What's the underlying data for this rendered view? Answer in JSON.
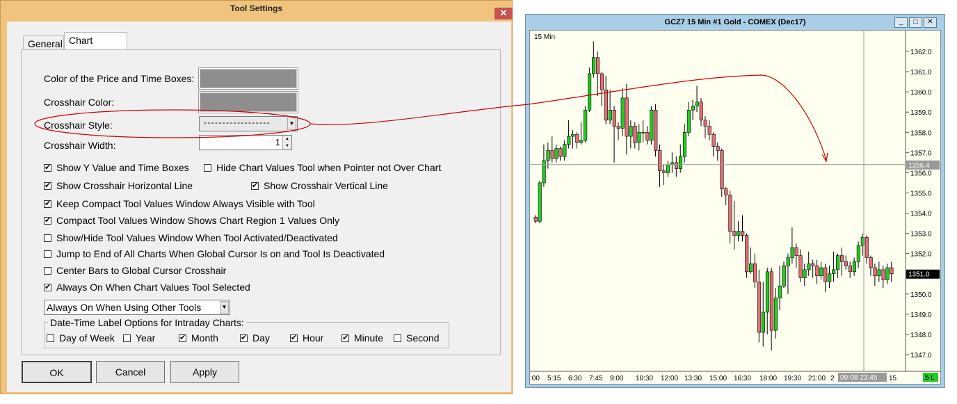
{
  "dialog": {
    "title": "Tool Settings",
    "close_glyph": "✕",
    "tabs": [
      {
        "label": "General"
      },
      {
        "label": "Chart Values"
      }
    ],
    "fields": {
      "price_time_boxes_color_label": "Color of the Price and Time Boxes:",
      "crosshair_color_label": "Crosshair Color:",
      "crosshair_style_label": "Crosshair Style:",
      "crosshair_style_value": "- - - - - - - - - - - - - - - - - -",
      "crosshair_width_label": "Crosshair Width:",
      "crosshair_width_value": "1",
      "swatch_color": "#8e8e8e"
    },
    "checkboxes": [
      {
        "label": "Show Y Value and Time Boxes",
        "checked": true
      },
      {
        "label": "Hide Chart Values Tool when Pointer not Over Chart",
        "checked": false
      },
      {
        "label": "Show Crosshair Horizontal Line",
        "checked": true
      },
      {
        "label": "Show Crosshair Vertical Line",
        "checked": true
      },
      {
        "label": "Keep Compact Tool Values Window Always Visible with Tool",
        "checked": true
      },
      {
        "label": "Compact Tool Values Window Shows Chart Region 1 Values Only",
        "checked": true
      },
      {
        "label": "Show/Hide Tool Values Window When Tool Activated/Deactivated",
        "checked": false
      },
      {
        "label": "Jump to End of All Charts When Global Cursor Is on and Tool Is Deactivated",
        "checked": false
      },
      {
        "label": "Center Bars to Global Cursor Crosshair",
        "checked": false
      },
      {
        "label": "Always On When Chart Values Tool Selected",
        "checked": true
      }
    ],
    "mode_select_value": "Always On When Using Other Tools",
    "date_time_group": {
      "title": "Date-Time Label Options for Intraday Charts:",
      "options": [
        {
          "label": "Day of Week",
          "checked": false
        },
        {
          "label": "Year",
          "checked": false
        },
        {
          "label": "Month",
          "checked": true
        },
        {
          "label": "Day",
          "checked": true
        },
        {
          "label": "Hour",
          "checked": true
        },
        {
          "label": "Minute",
          "checked": true
        },
        {
          "label": "Second",
          "checked": false
        }
      ]
    },
    "buttons": {
      "ok": "OK",
      "cancel": "Cancel",
      "apply": "Apply"
    }
  },
  "chart_window": {
    "title": "GCZ7  15 Min  #1  Gold - COMEX (Dec17)",
    "buttons": [
      "_",
      "□",
      "✕"
    ],
    "period_label": "15 Min",
    "crosshair_price": "1356.4",
    "last_price": "1351.0",
    "crosshair_time": "09-08  23:45",
    "status_badge": "5 L",
    "colors": {
      "up": "#22cc22",
      "down": "#e07070",
      "background": "#fffff0",
      "annotation": "#d00000"
    }
  },
  "chart_data": {
    "type": "candlestick",
    "x_tick_labels": [
      ":00",
      "5:15",
      "6:30",
      "7:45",
      "9:00",
      "10:30",
      "12:00",
      "13:30",
      "15:00",
      "16:30",
      "18:00",
      "19:30",
      "21:00",
      "2",
      "15"
    ],
    "y_tick_labels": [
      "1362.0",
      "1361.0",
      "1360.0",
      "1359.0",
      "1358.0",
      "1357.0",
      "1356.0",
      "1355.0",
      "1354.0",
      "1353.0",
      "1352.0",
      "1351.0",
      "1350.0",
      "1349.0",
      "1348.0",
      "1347.0"
    ],
    "ylim": [
      1346.5,
      1363.0
    ],
    "crosshair": {
      "price": 1356.4,
      "time": "09-08 23:45"
    },
    "candles": [
      [
        1353.8,
        1353.6,
        1353.9,
        1353.5
      ],
      [
        1353.6,
        1355.5,
        1355.6,
        1353.5
      ],
      [
        1355.5,
        1356.6,
        1357.4,
        1355.3
      ],
      [
        1356.6,
        1357.1,
        1357.5,
        1356.2
      ],
      [
        1357.1,
        1356.7,
        1357.8,
        1356.5
      ],
      [
        1356.7,
        1357.2,
        1357.4,
        1356.5
      ],
      [
        1357.2,
        1356.8,
        1357.3,
        1356.6
      ],
      [
        1356.8,
        1357.4,
        1357.6,
        1356.6
      ],
      [
        1357.4,
        1357.8,
        1358.6,
        1357.2
      ],
      [
        1357.8,
        1357.9,
        1358.1,
        1357.2
      ],
      [
        1357.9,
        1357.5,
        1358.0,
        1357.2
      ],
      [
        1357.5,
        1357.6,
        1358.5,
        1357.4
      ],
      [
        1357.6,
        1359.1,
        1359.3,
        1357.5
      ],
      [
        1359.1,
        1360.9,
        1361.2,
        1359.0
      ],
      [
        1360.9,
        1361.7,
        1362.5,
        1360.7
      ],
      [
        1361.7,
        1360.9,
        1362.0,
        1359.8
      ],
      [
        1360.9,
        1360.1,
        1361.0,
        1359.3
      ],
      [
        1360.1,
        1358.6,
        1360.8,
        1358.4
      ],
      [
        1358.6,
        1359.1,
        1360.1,
        1358.4
      ],
      [
        1359.1,
        1358.3,
        1359.3,
        1356.5
      ],
      [
        1358.3,
        1358.2,
        1358.5,
        1357.6
      ],
      [
        1358.2,
        1359.7,
        1360.2,
        1357.8
      ],
      [
        1359.7,
        1357.8,
        1360.4,
        1356.9
      ],
      [
        1357.8,
        1358.3,
        1358.6,
        1357.2
      ],
      [
        1358.3,
        1357.5,
        1358.5,
        1357.2
      ],
      [
        1357.5,
        1358.0,
        1358.4,
        1357.1
      ],
      [
        1358.0,
        1358.0,
        1358.6,
        1357.5
      ],
      [
        1358.0,
        1357.6,
        1358.3,
        1357.4
      ],
      [
        1357.6,
        1359.1,
        1359.3,
        1357.4
      ],
      [
        1359.1,
        1357.1,
        1359.4,
        1356.8
      ],
      [
        1357.1,
        1356.1,
        1357.4,
        1355.3
      ],
      [
        1356.1,
        1356.0,
        1356.4,
        1355.4
      ],
      [
        1356.0,
        1356.4,
        1356.6,
        1355.8
      ],
      [
        1356.4,
        1356.5,
        1357.0,
        1356.0
      ],
      [
        1356.5,
        1356.2,
        1356.8,
        1355.8
      ],
      [
        1356.2,
        1356.8,
        1357.4,
        1356.0
      ],
      [
        1356.8,
        1358.0,
        1358.4,
        1356.5
      ],
      [
        1358.0,
        1359.1,
        1359.5,
        1357.8
      ],
      [
        1359.1,
        1359.3,
        1359.6,
        1358.6
      ],
      [
        1359.3,
        1359.5,
        1360.3,
        1359.0
      ],
      [
        1359.5,
        1358.6,
        1359.7,
        1358.3
      ],
      [
        1358.6,
        1358.3,
        1358.8,
        1357.7
      ],
      [
        1358.3,
        1357.9,
        1358.6,
        1357.6
      ],
      [
        1357.9,
        1357.3,
        1358.0,
        1356.8
      ],
      [
        1357.3,
        1357.1,
        1357.5,
        1356.6
      ],
      [
        1357.1,
        1355.2,
        1357.2,
        1354.8
      ],
      [
        1355.2,
        1354.9,
        1355.3,
        1354.4
      ],
      [
        1354.9,
        1353.1,
        1355.1,
        1352.5
      ],
      [
        1353.1,
        1352.9,
        1354.6,
        1352.2
      ],
      [
        1352.9,
        1353.1,
        1353.6,
        1352.6
      ],
      [
        1353.1,
        1352.9,
        1353.9,
        1352.6
      ],
      [
        1352.9,
        1351.1,
        1353.0,
        1350.8
      ],
      [
        1351.1,
        1351.5,
        1352.3,
        1351.0
      ],
      [
        1351.5,
        1350.6,
        1352.0,
        1350.3
      ],
      [
        1350.6,
        1348.1,
        1351.2,
        1347.6
      ],
      [
        1348.1,
        1349.1,
        1350.6,
        1347.4
      ],
      [
        1349.1,
        1351.1,
        1351.3,
        1348.0
      ],
      [
        1351.1,
        1348.2,
        1351.3,
        1347.2
      ],
      [
        1348.2,
        1349.8,
        1350.3,
        1347.8
      ],
      [
        1349.8,
        1350.4,
        1351.4,
        1349.2
      ],
      [
        1350.4,
        1351.4,
        1351.6,
        1350.3
      ],
      [
        1351.4,
        1351.8,
        1352.0,
        1350.0
      ],
      [
        1351.8,
        1352.3,
        1353.3,
        1351.5
      ],
      [
        1352.3,
        1351.9,
        1352.5,
        1351.3
      ],
      [
        1351.9,
        1350.8,
        1352.2,
        1350.6
      ],
      [
        1350.8,
        1351.2,
        1351.5,
        1350.4
      ],
      [
        1351.2,
        1351.5,
        1352.1,
        1350.9
      ],
      [
        1351.5,
        1351.4,
        1351.7,
        1350.8
      ],
      [
        1351.4,
        1350.9,
        1351.7,
        1350.5
      ],
      [
        1350.9,
        1351.3,
        1351.6,
        1350.7
      ],
      [
        1351.3,
        1350.6,
        1351.5,
        1350.1
      ],
      [
        1350.6,
        1351.0,
        1351.4,
        1350.3
      ],
      [
        1351.0,
        1351.2,
        1352.1,
        1350.6
      ],
      [
        1351.2,
        1351.9,
        1352.0,
        1350.8
      ],
      [
        1351.9,
        1351.6,
        1352.3,
        1350.9
      ],
      [
        1351.6,
        1351.4,
        1351.9,
        1351.2
      ],
      [
        1351.4,
        1351.1,
        1351.6,
        1350.8
      ],
      [
        1351.1,
        1351.6,
        1351.8,
        1350.9
      ],
      [
        1351.6,
        1352.4,
        1352.6,
        1351.3
      ],
      [
        1352.4,
        1352.8,
        1353.0,
        1351.9
      ],
      [
        1352.8,
        1351.8,
        1352.9,
        1351.5
      ],
      [
        1351.8,
        1351.3,
        1351.9,
        1350.9
      ],
      [
        1351.3,
        1350.9,
        1351.5,
        1350.4
      ],
      [
        1350.9,
        1351.2,
        1351.6,
        1350.6
      ],
      [
        1351.2,
        1350.7,
        1351.4,
        1350.3
      ],
      [
        1350.7,
        1351.3,
        1351.5,
        1350.5
      ],
      [
        1351.3,
        1351.0,
        1351.6,
        1350.6
      ]
    ]
  }
}
